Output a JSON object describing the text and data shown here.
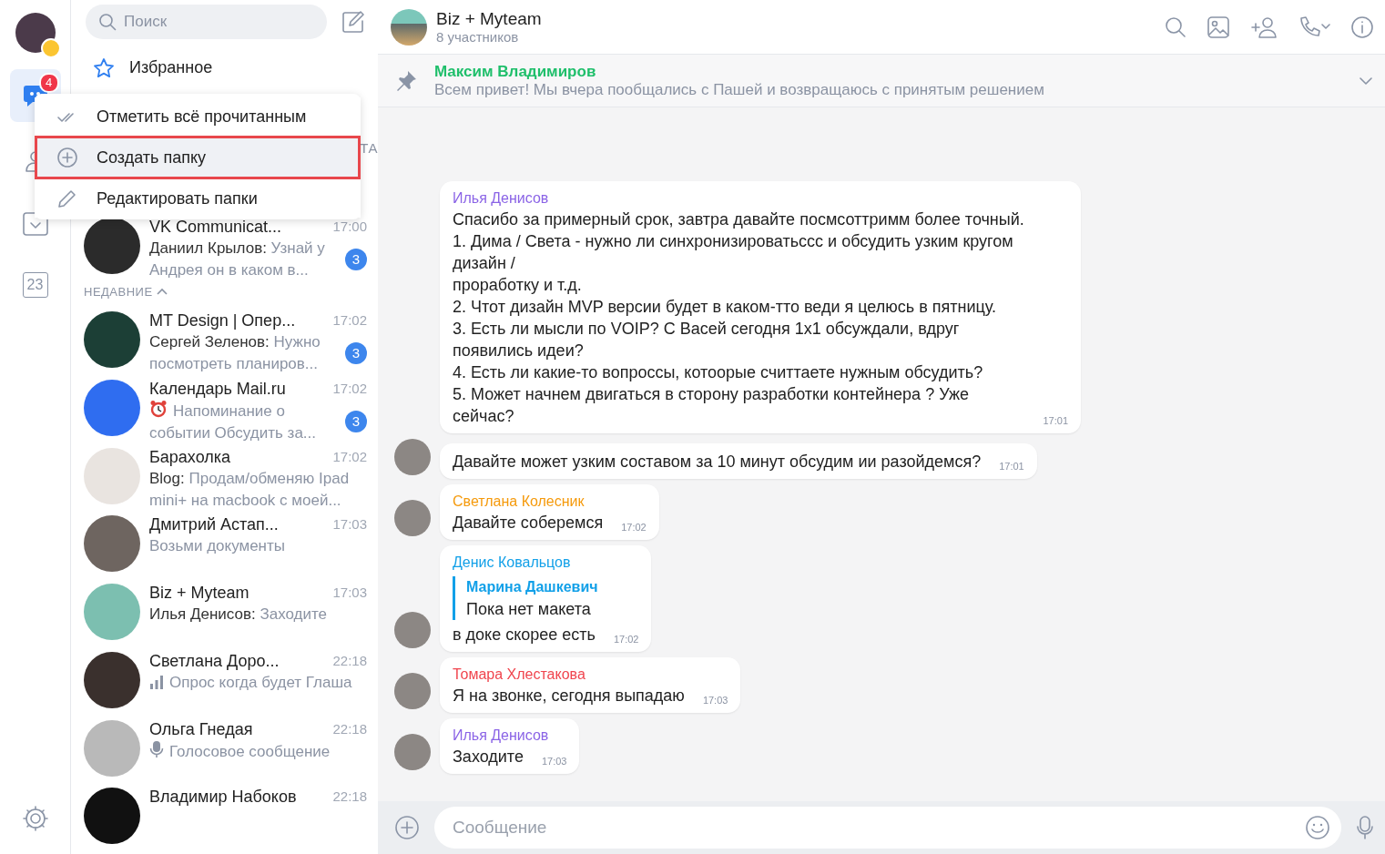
{
  "rail": {
    "items": [
      {
        "kind": "chats",
        "badge": "4",
        "selected": true
      },
      {
        "kind": "contacts",
        "selected": false
      },
      {
        "kind": "tasks",
        "selected": false
      },
      {
        "kind": "calendar",
        "label": "23",
        "selected": false
      }
    ]
  },
  "search": {
    "placeholder": "Поиск"
  },
  "favorites": {
    "label": "Избранное"
  },
  "context_menu": {
    "items": [
      {
        "kind": "check",
        "label": "Отметить всё прочитанным",
        "selected": false
      },
      {
        "kind": "plus",
        "label": "Создать папку",
        "selected": true
      },
      {
        "kind": "pencil",
        "label": "Редактировать папки",
        "selected": false
      }
    ]
  },
  "hidden_section_label": "ТА",
  "pinned_chats": [
    {
      "kind": "text",
      "name": "VK Communicat...",
      "time": "17:00",
      "sender": "Даниил Крылов:",
      "preview": "Узнай у Андрея он в каком в...",
      "unread": "3"
    }
  ],
  "recent_section": {
    "label": "НЕДАВНИЕ",
    "expanded": true
  },
  "chats": [
    {
      "kind": "text",
      "name": "MT Design | Опер...",
      "time": "17:02",
      "sender": "Сергей Зеленов:",
      "preview": "Нужно посмотреть планиров...",
      "unread": "3"
    },
    {
      "kind": "reminder",
      "name": "Календарь Mail.ru",
      "time": "17:02",
      "preview": "Напоминание о событии Обсудить за...",
      "unread": "3"
    },
    {
      "kind": "text",
      "name": "Барахолка",
      "time": "17:02",
      "sender": "Blog:",
      "preview": "Продам/обменяю Ipad mini+ на macbook с моей..."
    },
    {
      "kind": "text",
      "name": "Дмитрий Астап...",
      "time": "17:03",
      "preview": "Возьми документы"
    },
    {
      "kind": "text",
      "name": "Biz + Myteam",
      "time": "17:03",
      "sender": "Илья Денисов:",
      "preview": "Заходите"
    },
    {
      "kind": "poll",
      "name": "Светлана Доро...",
      "time": "22:18",
      "preview": "Опрос когда будет Глаша"
    },
    {
      "kind": "voice",
      "name": "Ольга Гнедая",
      "time": "22:18",
      "preview": "Голосовое сообщение"
    },
    {
      "name": "Владимир Набоков",
      "time": "22:18"
    }
  ],
  "header": {
    "title": "Biz + Myteam",
    "subtitle": "8 участников"
  },
  "pinned_message": {
    "author": "Максим Владимиров",
    "color": "#1fbf6b",
    "text": "Всем привет! Мы вчера пообщались с Пашей и возвращаюсь с принятым решением"
  },
  "messages": [
    {
      "author": "Илья Денисов",
      "color": "#8a63e6",
      "avatar": false,
      "text": "Спасибо за примерный срок, завтра давайте посмсоттримм более точный.\n1. Дима / Света - нужно ли синхронизироватьссс и обсудить узким кругом дизайн /\nпроработку и т.д.\n2. Чтот дизайн MVP версии будет в каком-тто веди я целюсь в пятницу.\n3. Есть ли мысли по VOIP? С Васей сегодня 1х1 обсуждали, вдруг появились идеи?\n4. Есть ли какие-то вопроссы, котоорые считтаете нужным обсудить?\n5. Может начнем двигаться в сторону разработки контейнера ? Уже сейчас?",
      "time": "17:01"
    },
    {
      "avatar": true,
      "text": "Давайте может узким составом за 10 минут обсудим ии разойдемся?",
      "time": "17:01"
    },
    {
      "author": "Светлана Колесник",
      "color": "#f59a0c",
      "avatar": true,
      "text": "Давайте соберемся",
      "time": "17:02"
    },
    {
      "author": "Денис Ковальцов",
      "color": "#12a0e8",
      "avatar": true,
      "quote": {
        "author": "Марина Дашкевич",
        "text": "Пока нет макета"
      },
      "text": "в доке скорее есть",
      "time": "17:02"
    },
    {
      "author": "Томара Хлестакова",
      "color": "#f0454e",
      "avatar": true,
      "text": "Я на звонке, сегодня выпадаю",
      "time": "17:03"
    },
    {
      "author": "Илья Денисов",
      "color": "#8a63e6",
      "avatar": true,
      "text": "Заходите",
      "time": "17:03"
    }
  ],
  "composer": {
    "placeholder": "Сообщение"
  }
}
